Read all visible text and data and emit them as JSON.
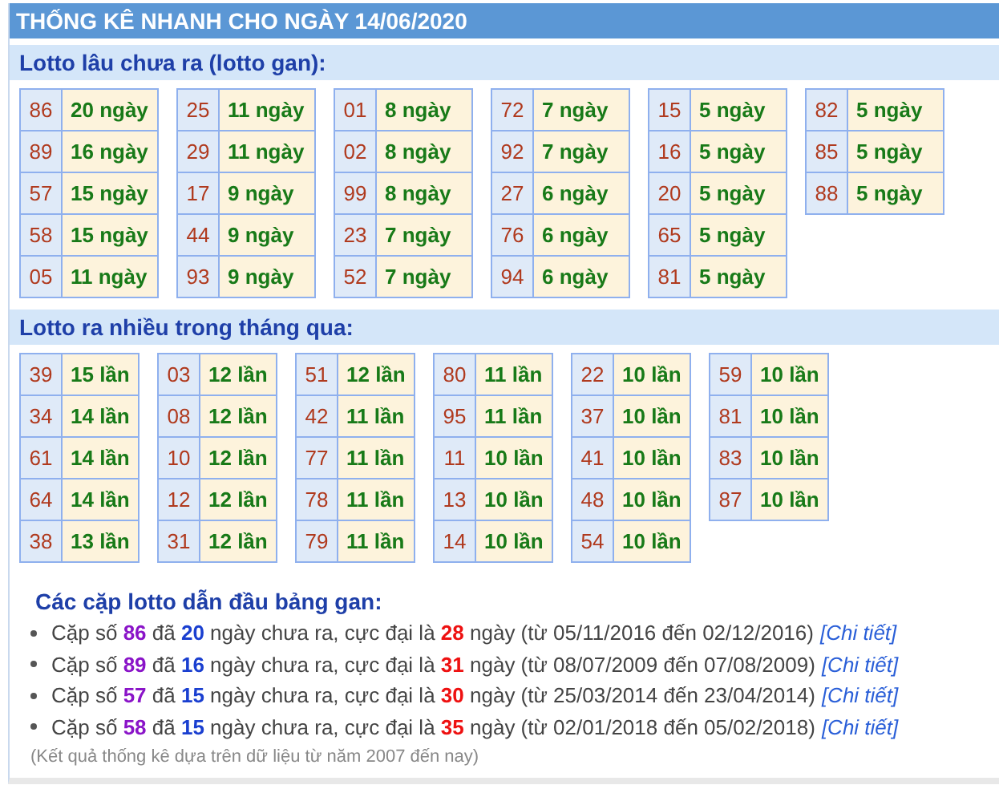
{
  "title": "THỐNG KÊ NHANH CHO NGÀY 14/06/2020",
  "sections": [
    {
      "heading": "Lotto lâu chưa ra (lotto gan):",
      "kind": "gan",
      "tables": [
        [
          [
            "86",
            "20 ngày"
          ],
          [
            "89",
            "16 ngày"
          ],
          [
            "57",
            "15 ngày"
          ],
          [
            "58",
            "15 ngày"
          ],
          [
            "05",
            "11 ngày"
          ]
        ],
        [
          [
            "25",
            "11 ngày"
          ],
          [
            "29",
            "11 ngày"
          ],
          [
            "17",
            "9 ngày"
          ],
          [
            "44",
            "9 ngày"
          ],
          [
            "93",
            "9 ngày"
          ]
        ],
        [
          [
            "01",
            "8 ngày"
          ],
          [
            "02",
            "8 ngày"
          ],
          [
            "99",
            "8 ngày"
          ],
          [
            "23",
            "7 ngày"
          ],
          [
            "52",
            "7 ngày"
          ]
        ],
        [
          [
            "72",
            "7 ngày"
          ],
          [
            "92",
            "7 ngày"
          ],
          [
            "27",
            "6 ngày"
          ],
          [
            "76",
            "6 ngày"
          ],
          [
            "94",
            "6 ngày"
          ]
        ],
        [
          [
            "15",
            "5 ngày"
          ],
          [
            "16",
            "5 ngày"
          ],
          [
            "20",
            "5 ngày"
          ],
          [
            "65",
            "5 ngày"
          ],
          [
            "81",
            "5 ngày"
          ]
        ],
        [
          [
            "82",
            "5 ngày"
          ],
          [
            "85",
            "5 ngày"
          ],
          [
            "88",
            "5 ngày"
          ]
        ]
      ]
    },
    {
      "heading": "Lotto ra nhiều trong tháng qua:",
      "kind": "nhieu",
      "tables": [
        [
          [
            "39",
            "15 lần"
          ],
          [
            "34",
            "14 lần"
          ],
          [
            "61",
            "14 lần"
          ],
          [
            "64",
            "14 lần"
          ],
          [
            "38",
            "13 lần"
          ]
        ],
        [
          [
            "03",
            "12 lần"
          ],
          [
            "08",
            "12 lần"
          ],
          [
            "10",
            "12 lần"
          ],
          [
            "12",
            "12 lần"
          ],
          [
            "31",
            "12 lần"
          ]
        ],
        [
          [
            "51",
            "12 lần"
          ],
          [
            "42",
            "11 lần"
          ],
          [
            "77",
            "11 lần"
          ],
          [
            "78",
            "11 lần"
          ],
          [
            "79",
            "11 lần"
          ]
        ],
        [
          [
            "80",
            "11 lần"
          ],
          [
            "95",
            "11 lần"
          ],
          [
            "11",
            "10 lần"
          ],
          [
            "13",
            "10 lần"
          ],
          [
            "14",
            "10 lần"
          ]
        ],
        [
          [
            "22",
            "10 lần"
          ],
          [
            "37",
            "10 lần"
          ],
          [
            "41",
            "10 lần"
          ],
          [
            "48",
            "10 lần"
          ],
          [
            "54",
            "10 lần"
          ]
        ],
        [
          [
            "59",
            "10 lần"
          ],
          [
            "81",
            "10 lần"
          ],
          [
            "83",
            "10 lần"
          ],
          [
            "87",
            "10 lần"
          ]
        ]
      ]
    }
  ],
  "pairs": {
    "heading": "Các cặp lotto dẫn đầu bảng gan:",
    "items": [
      {
        "segments": [
          {
            "kind": "plain",
            "text": "Cặp số "
          },
          {
            "kind": "pair",
            "text": "86"
          },
          {
            "kind": "plain",
            "text": " đã "
          },
          {
            "kind": "days",
            "text": "20"
          },
          {
            "kind": "plain",
            "text": " ngày chưa ra, cực đại là "
          },
          {
            "kind": "max",
            "text": "28"
          },
          {
            "kind": "plain",
            "text": " ngày (từ 05/11/2016 đến 02/12/2016)"
          }
        ],
        "link": "[Chi tiết]"
      },
      {
        "segments": [
          {
            "kind": "plain",
            "text": "Cặp số "
          },
          {
            "kind": "pair",
            "text": "89"
          },
          {
            "kind": "plain",
            "text": " đã "
          },
          {
            "kind": "days",
            "text": "16"
          },
          {
            "kind": "plain",
            "text": " ngày chưa ra, cực đại là "
          },
          {
            "kind": "max",
            "text": "31"
          },
          {
            "kind": "plain",
            "text": " ngày (từ 08/07/2009 đến 07/08/2009)"
          }
        ],
        "link": "[Chi tiết]"
      },
      {
        "segments": [
          {
            "kind": "plain",
            "text": "Cặp số "
          },
          {
            "kind": "pair",
            "text": "57"
          },
          {
            "kind": "plain",
            "text": " đã "
          },
          {
            "kind": "days",
            "text": "15"
          },
          {
            "kind": "plain",
            "text": " ngày chưa ra, cực đại là "
          },
          {
            "kind": "max",
            "text": "30"
          },
          {
            "kind": "plain",
            "text": " ngày (từ 25/03/2014 đến 23/04/2014)"
          }
        ],
        "link": "[Chi tiết]"
      },
      {
        "segments": [
          {
            "kind": "plain",
            "text": "Cặp số "
          },
          {
            "kind": "pair",
            "text": "58"
          },
          {
            "kind": "plain",
            "text": " đã "
          },
          {
            "kind": "days",
            "text": "15"
          },
          {
            "kind": "plain",
            "text": " ngày chưa ra, cực đại là "
          },
          {
            "kind": "max",
            "text": "35"
          },
          {
            "kind": "plain",
            "text": " ngày (từ 02/01/2018 đến 05/02/2018)"
          }
        ],
        "link": "[Chi tiết]"
      }
    ],
    "note": "(Kết quả thống kê dựa trên dữ liệu từ năm 2007 đến nay)"
  }
}
